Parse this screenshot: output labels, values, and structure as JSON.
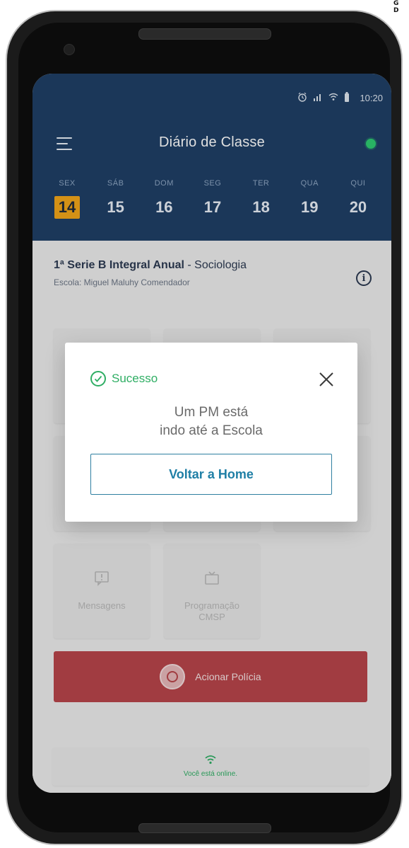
{
  "corner": {
    "text": "G\nD"
  },
  "status_bar": {
    "time": "10:20",
    "icons": [
      "alarm-icon",
      "signal-icon",
      "wifi-icon",
      "battery-icon"
    ]
  },
  "app": {
    "title": "Diário de Classe",
    "online_indicator_color": "#2ecc71",
    "header_color": "#1f3f66"
  },
  "days": [
    {
      "name": "SEX",
      "num": "14",
      "selected": true
    },
    {
      "name": "SÁB",
      "num": "15",
      "selected": false
    },
    {
      "name": "DOM",
      "num": "16",
      "selected": false
    },
    {
      "name": "SEG",
      "num": "17",
      "selected": false
    },
    {
      "name": "TER",
      "num": "18",
      "selected": false
    },
    {
      "name": "QUA",
      "num": "19",
      "selected": false
    },
    {
      "name": "QUI",
      "num": "20",
      "selected": false
    }
  ],
  "class_info": {
    "title_bold": "1ª Serie B Integral Anual",
    "title_rest": " - Sociologia",
    "school": "Escola: Miguel Maluhy Comendador"
  },
  "tiles": [
    {
      "label": "Mensagens",
      "icon": "message-alert-icon"
    },
    {
      "label": "Programação CMSP",
      "icon": "tv-icon"
    }
  ],
  "police_button": {
    "label": "Acionar Polícia",
    "color": "#b8454a",
    "icon": "police-badge-icon"
  },
  "online_bar": {
    "text": "Você está online.",
    "icon": "wifi-icon"
  },
  "modal": {
    "status": "Sucesso",
    "message_line1": "Um PM está",
    "message_line2": "indo até a Escola",
    "button_label": "Voltar a Home",
    "success_color": "#2fae64"
  }
}
